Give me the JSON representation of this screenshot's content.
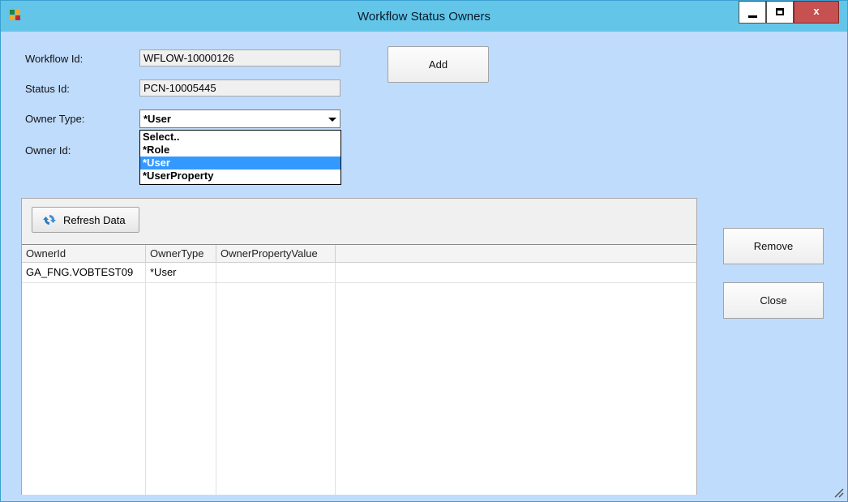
{
  "window": {
    "title": "Workflow Status Owners",
    "close_glyph": "x"
  },
  "form": {
    "workflow_id_label": "Workflow Id:",
    "workflow_id_value": "WFLOW-10000126",
    "status_id_label": "Status Id:",
    "status_id_value": "PCN-10005445",
    "owner_type_label": "Owner Type:",
    "owner_type_value": "*User",
    "owner_type_options": [
      "Select..",
      "*Role",
      "*User",
      "*UserProperty"
    ],
    "owner_id_label": "Owner Id:"
  },
  "buttons": {
    "add": "Add",
    "remove": "Remove",
    "close": "Close",
    "refresh": "Refresh Data"
  },
  "grid": {
    "columns": [
      "OwnerId",
      "OwnerType",
      "OwnerPropertyValue"
    ],
    "rows": [
      [
        "GA_FNG.VOBTEST09",
        "*User",
        ""
      ]
    ]
  },
  "icons": {
    "app": "app-icon",
    "refresh": "refresh-icon",
    "resize": "resize-grip-icon"
  },
  "colors": {
    "titlebar": "#63c6e9",
    "client": "#c0dcfc",
    "selection": "#3399ff",
    "close": "#c75050"
  }
}
